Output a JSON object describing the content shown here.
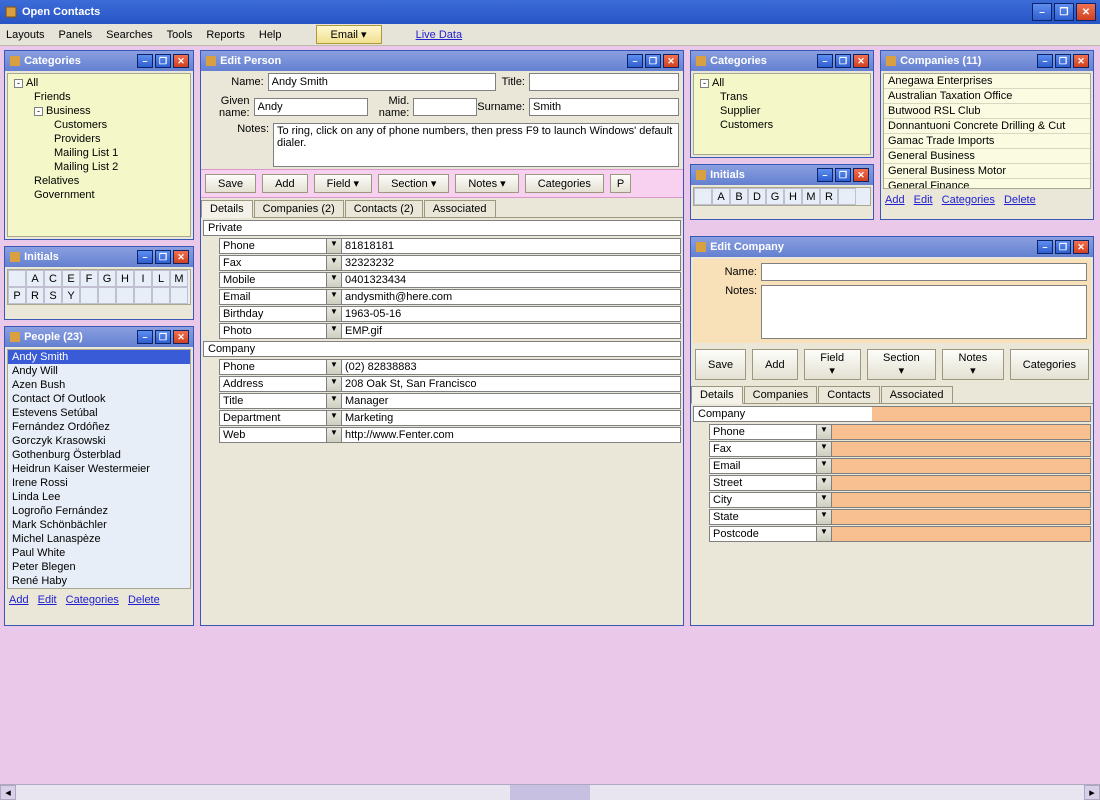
{
  "app": {
    "title": "Open Contacts"
  },
  "menu": {
    "items": [
      "Layouts",
      "Panels",
      "Searches",
      "Tools",
      "Reports",
      "Help"
    ],
    "email": "Email ▾",
    "livedata": "Live Data"
  },
  "categories_left": {
    "title": "Categories",
    "tree": [
      {
        "label": "All",
        "exp": "-",
        "ind": 0
      },
      {
        "label": "Friends",
        "ind": 1
      },
      {
        "label": "Business",
        "exp": "-",
        "ind": 1
      },
      {
        "label": "Customers",
        "ind": 2
      },
      {
        "label": "Providers",
        "ind": 2
      },
      {
        "label": "Mailing List 1",
        "ind": 2
      },
      {
        "label": "Mailing List 2",
        "ind": 2
      },
      {
        "label": "Relatives",
        "ind": 1
      },
      {
        "label": "Government",
        "ind": 1
      }
    ]
  },
  "initials_left": {
    "title": "Initials",
    "row1": [
      "",
      "A",
      "C",
      "E",
      "F",
      "G",
      "H",
      "I",
      "L",
      "M"
    ],
    "row2": [
      "P",
      "R",
      "S",
      "Y",
      "",
      "",
      "",
      "",
      "",
      ""
    ]
  },
  "people": {
    "title": "People (23)",
    "items": [
      "Andy Smith",
      "Andy Will",
      "Azen Bush",
      "Contact Of Outlook",
      "Estevens Setúbal",
      "Fernández Ordóñez",
      "Gorczyk Krasowski",
      "Gothenburg Österblad",
      "Heidrun Kaiser Westermeier",
      "Irene Rossi",
      "Linda Lee",
      "Logroño Fernández",
      "Mark Schönbächler",
      "Michel Lanaspèze",
      "Paul White",
      "Peter Blegen",
      "René Haby"
    ],
    "selected": 0,
    "links": [
      "Add",
      "Edit",
      "Categories",
      "Delete"
    ]
  },
  "edit_person": {
    "title": "Edit Person",
    "labels": {
      "name": "Name:",
      "title": "Title:",
      "given": "Given name:",
      "mid": "Mid. name:",
      "surname": "Surname:",
      "notes": "Notes:"
    },
    "values": {
      "name": "Andy Smith",
      "title": "",
      "given": "Andy",
      "mid": "",
      "surname": "Smith",
      "notes": "To ring, click on any of phone numbers, then press F9 to launch Windows' default dialer."
    },
    "buttons": {
      "save": "Save",
      "add": "Add",
      "field": "Field ▾",
      "section": "Section ▾",
      "notes": "Notes ▾",
      "categories": "Categories",
      "p": "P"
    },
    "tabs": [
      "Details",
      "Companies (2)",
      "Contacts (2)",
      "Associated"
    ],
    "sections": [
      {
        "hdr": "Private",
        "fields": [
          {
            "name": "Phone",
            "val": "81818181"
          },
          {
            "name": "Fax",
            "val": "32323232"
          },
          {
            "name": "Mobile",
            "val": "0401323434"
          },
          {
            "name": "Email",
            "val": "andysmith@here.com"
          },
          {
            "name": "Birthday",
            "val": "1963-05-16"
          },
          {
            "name": "Photo",
            "val": "EMP.gif"
          }
        ]
      },
      {
        "hdr": "Company",
        "fields": [
          {
            "name": "Phone",
            "val": "(02)  82838883"
          },
          {
            "name": "Address",
            "val": "208 Oak St, San Francisco"
          },
          {
            "name": "Title",
            "val": "Manager"
          },
          {
            "name": "Department",
            "val": "Marketing"
          },
          {
            "name": "Web",
            "val": "http://www.Fenter.com"
          }
        ]
      }
    ]
  },
  "categories_right": {
    "title": "Categories",
    "tree": [
      {
        "label": "All",
        "exp": "-",
        "ind": 0
      },
      {
        "label": "Trans",
        "ind": 1
      },
      {
        "label": "Supplier",
        "ind": 1
      },
      {
        "label": "Customers",
        "ind": 1
      }
    ]
  },
  "initials_right": {
    "title": "Initials",
    "row1": [
      "",
      "A",
      "B",
      "D",
      "G",
      "H",
      "M",
      "R",
      ""
    ]
  },
  "companies": {
    "title": "Companies (11)",
    "items": [
      "Anegawa Enterprises",
      "Australian Taxation Office",
      "Butwood RSL Club",
      "Donnantuoni Concrete Drilling & Cut",
      "Gamac Trade Imports",
      "General Business",
      "General Business Motor",
      "General Finance"
    ],
    "links": [
      "Add",
      "Edit",
      "Categories",
      "Delete"
    ]
  },
  "edit_company": {
    "title": "Edit Company",
    "labels": {
      "name": "Name:",
      "notes": "Notes:"
    },
    "values": {
      "name": "",
      "notes": ""
    },
    "buttons": {
      "save": "Save",
      "add": "Add",
      "field": "Field ▾",
      "section": "Section ▾",
      "notes": "Notes ▾",
      "categories": "Categories"
    },
    "tabs": [
      "Details",
      "Companies",
      "Contacts",
      "Associated"
    ],
    "sections": [
      {
        "hdr": "Company",
        "fields": [
          {
            "name": "Phone",
            "val": ""
          },
          {
            "name": "Fax",
            "val": ""
          },
          {
            "name": "Email",
            "val": ""
          },
          {
            "name": "Street",
            "val": ""
          },
          {
            "name": "City",
            "val": ""
          },
          {
            "name": "State",
            "val": ""
          },
          {
            "name": "Postcode",
            "val": ""
          }
        ]
      }
    ]
  }
}
